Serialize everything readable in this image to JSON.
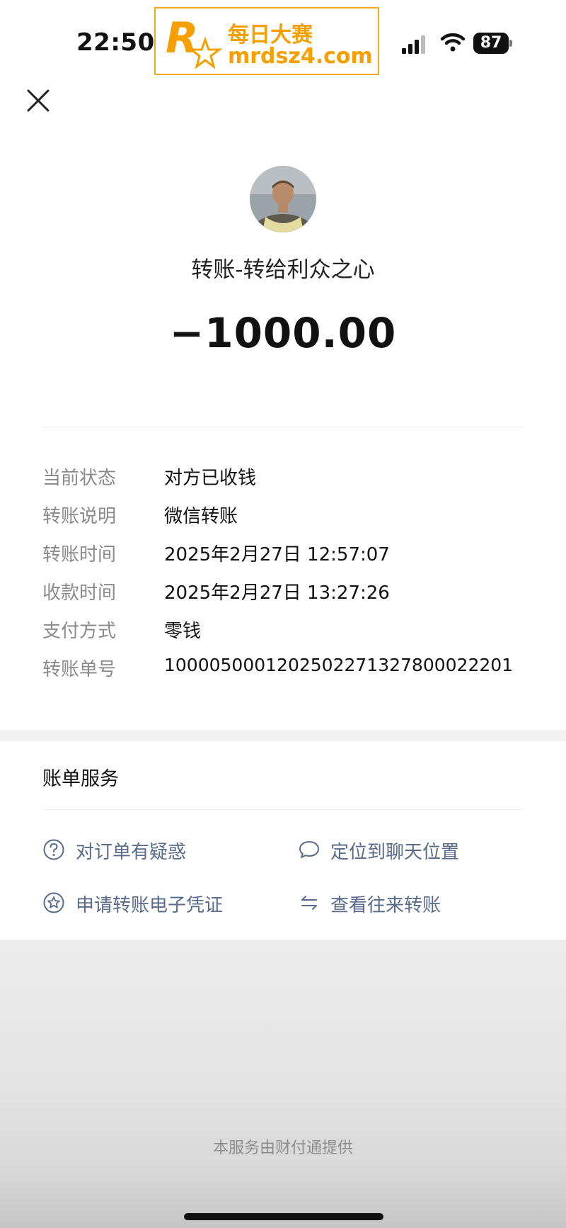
{
  "status_bar": {
    "time": "22:50",
    "battery": "87"
  },
  "watermark": {
    "title": "每日大赛",
    "url": "mrdsz4.com",
    "logo_text": "每日大赛"
  },
  "header": {
    "close_icon": "close-icon"
  },
  "transfer": {
    "title": "转账-转给利众之心",
    "amount": "−1000.00"
  },
  "details": [
    {
      "label": "当前状态",
      "value": "对方已收钱"
    },
    {
      "label": "转账说明",
      "value": "微信转账"
    },
    {
      "label": "转账时间",
      "value": "2025年2月27日 12:57:07"
    },
    {
      "label": "收款时间",
      "value": "2025年2月27日 13:27:26"
    },
    {
      "label": "支付方式",
      "value": "零钱"
    },
    {
      "label": "转账单号",
      "value": "10000500012025022713278000222​01"
    }
  ],
  "services": {
    "title": "账单服务",
    "items": [
      {
        "label": "对订单有疑惑",
        "icon": "question-circle-icon"
      },
      {
        "label": "定位到聊天位置",
        "icon": "chat-bubble-icon"
      },
      {
        "label": "申请转账电子凭证",
        "icon": "star-badge-icon"
      },
      {
        "label": "查看往来转账",
        "icon": "swap-arrows-icon"
      }
    ]
  },
  "footer": {
    "text": "本服务由财付通提供"
  },
  "colors": {
    "watermark": "#f5a623",
    "service_text": "#5a6a8a",
    "label_gray": "#8a8a8a"
  }
}
